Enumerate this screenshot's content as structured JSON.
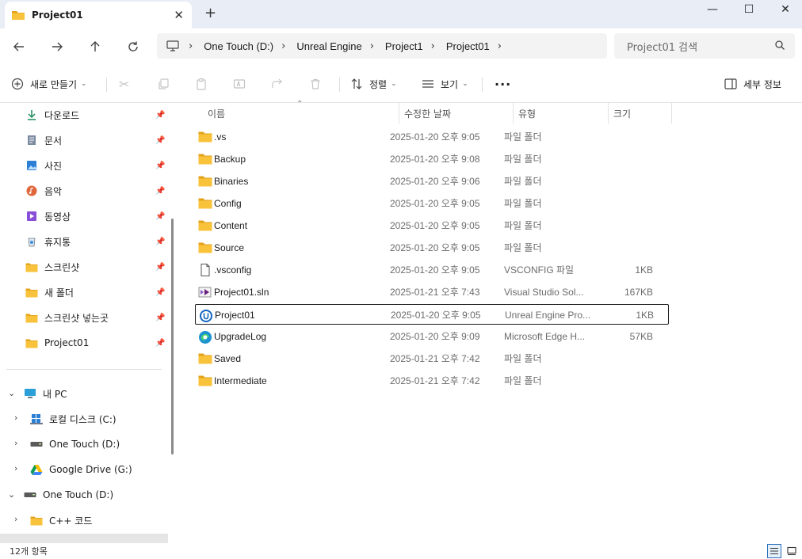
{
  "window": {
    "tab_title": "Project01",
    "new_tab_glyph": "+",
    "close_tab_glyph": "✕",
    "minimize_glyph": "—",
    "maximize_glyph": "☐",
    "close_glyph": "✕"
  },
  "nav": {
    "back_icon": "arrow-left",
    "forward_icon": "arrow-right",
    "up_icon": "arrow-up",
    "refresh_icon": "refresh",
    "breadcrumbs": [
      "One Touch (D:)",
      "Unreal Engine",
      "Project1",
      "Project01"
    ],
    "search_placeholder": "Project01 검색"
  },
  "toolbar": {
    "new_label": "새로 만들기",
    "sort_label": "정렬",
    "view_label": "보기",
    "more_label": "···",
    "details_label": "세부 정보"
  },
  "sidebar": {
    "quick_access": [
      {
        "label": "다운로드",
        "icon": "download-icon",
        "pinned": true
      },
      {
        "label": "문서",
        "icon": "document-icon",
        "pinned": true
      },
      {
        "label": "사진",
        "icon": "pictures-icon",
        "pinned": true
      },
      {
        "label": "음악",
        "icon": "music-icon",
        "pinned": true
      },
      {
        "label": "동영상",
        "icon": "video-icon",
        "pinned": true
      },
      {
        "label": "휴지통",
        "icon": "recycle-bin-icon",
        "pinned": true
      },
      {
        "label": "스크린샷",
        "icon": "folder-icon",
        "pinned": true
      },
      {
        "label": "새 폴더",
        "icon": "folder-icon",
        "pinned": true
      },
      {
        "label": "스크린샷 넣는곳",
        "icon": "folder-icon",
        "pinned": true
      },
      {
        "label": "Project01",
        "icon": "folder-icon",
        "pinned": true
      }
    ],
    "this_pc": {
      "label": "내 PC",
      "drives": [
        {
          "label": "로컬 디스크 (C:)",
          "icon": "windows-drive-icon"
        },
        {
          "label": "One Touch (D:)",
          "icon": "drive-icon"
        },
        {
          "label": "Google Drive (G:)",
          "icon": "google-drive-icon"
        }
      ]
    },
    "expanded_drive": {
      "label": "One Touch (D:)",
      "children": [
        {
          "label": "C++ 코드",
          "icon": "folder-icon"
        }
      ]
    }
  },
  "columns": {
    "name": "이름",
    "date": "수정한 날짜",
    "type": "유형",
    "size": "크기"
  },
  "files": [
    {
      "name": ".vs",
      "date": "2025-01-20 오후 9:05",
      "type": "파일 폴더",
      "size": "",
      "icon": "folder-icon"
    },
    {
      "name": "Backup",
      "date": "2025-01-20 오후 9:08",
      "type": "파일 폴더",
      "size": "",
      "icon": "folder-icon"
    },
    {
      "name": "Binaries",
      "date": "2025-01-20 오후 9:06",
      "type": "파일 폴더",
      "size": "",
      "icon": "folder-icon"
    },
    {
      "name": "Config",
      "date": "2025-01-20 오후 9:05",
      "type": "파일 폴더",
      "size": "",
      "icon": "folder-icon"
    },
    {
      "name": "Content",
      "date": "2025-01-20 오후 9:05",
      "type": "파일 폴더",
      "size": "",
      "icon": "folder-icon"
    },
    {
      "name": "Source",
      "date": "2025-01-20 오후 9:05",
      "type": "파일 폴더",
      "size": "",
      "icon": "folder-icon"
    },
    {
      "name": ".vsconfig",
      "date": "2025-01-20 오후 9:05",
      "type": "VSCONFIG 파일",
      "size": "1KB",
      "icon": "file-icon"
    },
    {
      "name": "Project01.sln",
      "date": "2025-01-21 오후 7:43",
      "type": "Visual Studio Sol...",
      "size": "167KB",
      "icon": "visual-studio-solution-icon"
    },
    {
      "name": "Project01",
      "date": "2025-01-20 오후 9:05",
      "type": "Unreal Engine Pro...",
      "size": "1KB",
      "icon": "unreal-engine-icon",
      "selected": true
    },
    {
      "name": "UpgradeLog",
      "date": "2025-01-20 오후 9:09",
      "type": "Microsoft Edge H...",
      "size": "57KB",
      "icon": "edge-icon"
    },
    {
      "name": "Saved",
      "date": "2025-01-21 오후 7:42",
      "type": "파일 폴더",
      "size": "",
      "icon": "folder-icon"
    },
    {
      "name": "Intermediate",
      "date": "2025-01-21 오후 7:42",
      "type": "파일 폴더",
      "size": "",
      "icon": "folder-icon"
    }
  ],
  "status": {
    "item_count": "12개 항목"
  },
  "colors": {
    "folder": "#f8c23a",
    "folder_dark": "#e3a21a",
    "accent": "#2a6fb8",
    "titlebar_bg": "#e9edf6"
  }
}
